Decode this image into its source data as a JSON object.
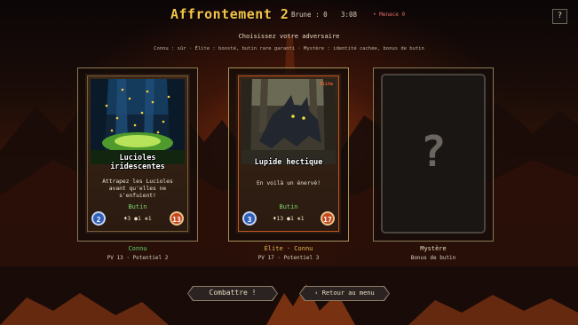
{
  "header": {
    "title": "Affrontement 2",
    "brune": "Brune : 0",
    "timer": "3:08",
    "menace": "• Menace 0",
    "help_label": "?"
  },
  "subtitle": "Choisissez votre adversaire",
  "legend": "Connu : sûr  ·  Élite : boosté, butin rare garanti  ·  Mystère : identité cachée, bonus de butin",
  "cards": [
    {
      "name_line1": "Lucioles",
      "name_line2": "iridescentes",
      "desc_line1": "Attrapez les Lucioles",
      "desc_line2": "avant qu'elles ne",
      "desc_line3": "s'enfuient!",
      "butin_label": "Butin",
      "left_value": "2",
      "right_value": "13",
      "loot": "♦3 ●1 ❖1",
      "type_label": "Connu",
      "type_color": "#5fd36a",
      "stats": "PV 13 · Potentiel 2"
    },
    {
      "name_line1": "Lupide hectique",
      "desc_line1": "En voilà un énervé!",
      "butin_label": "Butin",
      "left_value": "3",
      "right_value": "17",
      "loot": "♦13 ●1 ❖1",
      "badge": "Élite",
      "type_label": "Élite · Connu",
      "type_color": "#e8b64a",
      "stats": "PV 17 · Potentiel 3"
    },
    {
      "mystery_mark": "?",
      "type_label": "Mystère",
      "stats": "Bonus de butin"
    }
  ],
  "buttons": {
    "fight": "Combattre !",
    "back": "‹ Retour au menu"
  },
  "colors": {
    "title": "#f3c54a",
    "known": "#5fd36a",
    "elite": "#e8b64a",
    "menace": "#e46a6a"
  }
}
